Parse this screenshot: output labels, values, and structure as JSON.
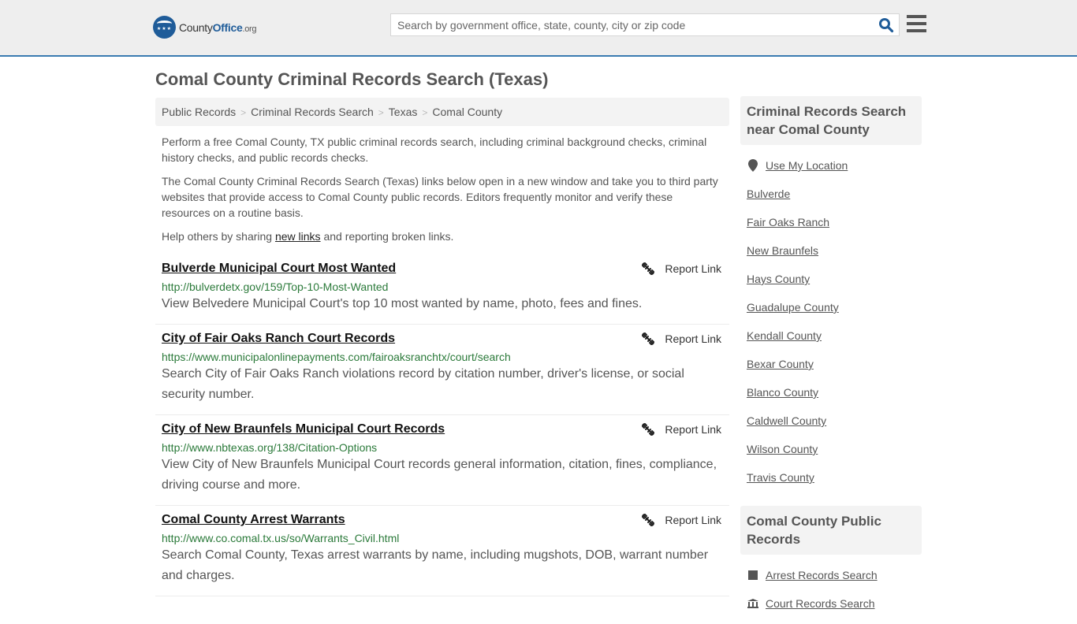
{
  "header": {
    "logo": {
      "county": "County",
      "office": "Office",
      "org": ".org",
      "stars": "★★★"
    },
    "search": {
      "placeholder": "Search by government office, state, county, city or zip code",
      "value": ""
    },
    "colors": {
      "brand": "#1f5c99",
      "accent_bar": "#3a7bb0"
    }
  },
  "page_title": "Comal County Criminal Records Search (Texas)",
  "breadcrumb": [
    {
      "label": "Public Records"
    },
    {
      "label": "Criminal Records Search"
    },
    {
      "label": "Texas"
    },
    {
      "label": "Comal County"
    }
  ],
  "breadcrumb_separator": ">",
  "intro": {
    "p1": "Perform a free Comal County, TX public criminal records search, including criminal background checks, criminal history checks, and public records checks.",
    "p2": "The Comal County Criminal Records Search (Texas) links below open in a new window and take you to third party websites that provide access to Comal County public records. Editors frequently monitor and verify these resources on a routine basis.",
    "p3_before": "Help others by sharing ",
    "p3_link": "new links",
    "p3_after": " and reporting broken links."
  },
  "results": [
    {
      "title": "Bulverde Municipal Court Most Wanted",
      "url": "http://bulverdetx.gov/159/Top-10-Most-Wanted",
      "description": "View Belvedere Municipal Court's top 10 most wanted by name, photo, fees and fines.",
      "report_label": "Report Link"
    },
    {
      "title": "City of Fair Oaks Ranch Court Records",
      "url": "https://www.municipalonlinepayments.com/fairoaksranchtx/court/search",
      "description": "Search City of Fair Oaks Ranch violations record by citation number, driver's license, or social security number.",
      "report_label": "Report Link"
    },
    {
      "title": "City of New Braunfels Municipal Court Records",
      "url": "http://www.nbtexas.org/138/Citation-Options",
      "description": "View City of New Braunfels Municipal Court records general information, citation, fines, compliance, driving course and more.",
      "report_label": "Report Link"
    },
    {
      "title": "Comal County Arrest Warrants",
      "url": "http://www.co.comal.tx.us/so/Warrants_Civil.html",
      "description": "Search Comal County, Texas arrest warrants by name, including mugshots, DOB, warrant number and charges.",
      "report_label": "Report Link"
    }
  ],
  "sidebar": {
    "nearby": {
      "heading": "Criminal Records Search near Comal County",
      "use_location": "Use My Location",
      "items": [
        "Bulverde",
        "Fair Oaks Ranch",
        "New Braunfels",
        "Hays County",
        "Guadalupe County",
        "Kendall County",
        "Bexar County",
        "Blanco County",
        "Caldwell County",
        "Wilson County",
        "Travis County"
      ]
    },
    "public_records": {
      "heading": "Comal County Public Records",
      "items": [
        {
          "label": "Arrest Records Search",
          "icon": "square-icon"
        },
        {
          "label": "Court Records Search",
          "icon": "courthouse-icon"
        }
      ]
    }
  }
}
